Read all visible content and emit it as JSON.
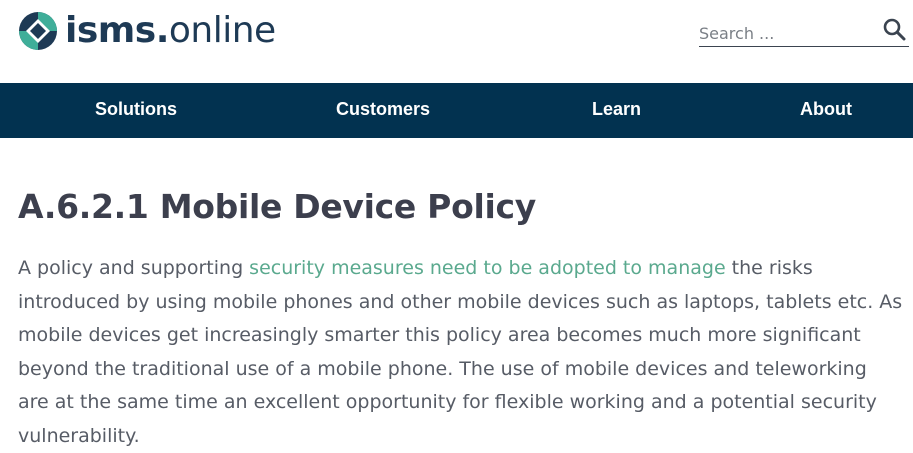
{
  "brand": {
    "name_bold": "isms.",
    "name_light": "online",
    "colors": {
      "navy": "#1e3a55",
      "teal": "#3fae99",
      "nav_bg": "#023250",
      "link": "#5aa98e"
    }
  },
  "search": {
    "placeholder": "Search ...",
    "icon": "search-icon"
  },
  "nav": {
    "items": [
      {
        "label": "Solutions"
      },
      {
        "label": "Customers"
      },
      {
        "label": "Learn"
      },
      {
        "label": "About"
      }
    ]
  },
  "article": {
    "title": "A.6.2.1 Mobile Device Policy",
    "paragraph": {
      "before_link": "A policy and supporting ",
      "link_text": "security measures need to be adopted to manage",
      "line1_after": " the risks",
      "line2": "introduced by using mobile phones and other mobile devices such as laptops, tablets etc. As",
      "line3": "mobile devices get increasingly smarter this policy area becomes much more significant",
      "line4": "beyond the traditional use of a mobile phone. The use of mobile devices and teleworking",
      "line5": "are at the same time an excellent opportunity for flexible working and a potential security",
      "line6": "vulnerability."
    }
  }
}
